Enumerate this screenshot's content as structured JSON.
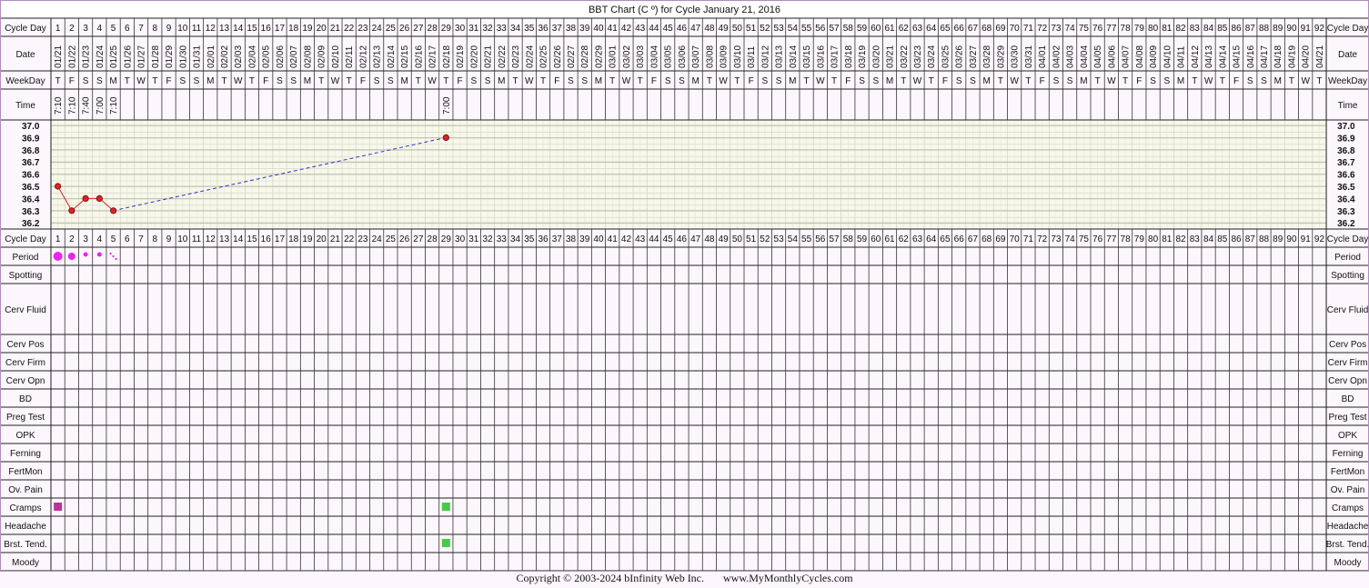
{
  "title": "BBT Chart (C º) for Cycle January 21, 2016",
  "row_labels": {
    "cycle_day": "Cycle Day",
    "date": "Date",
    "weekday": "WeekDay",
    "time": "Time",
    "period": "Period",
    "spotting": "Spotting",
    "cerv_fluid": "Cerv Fluid",
    "cerv_pos": "Cerv Pos",
    "cerv_firm": "Cerv Firm",
    "cerv_opn": "Cerv Opn",
    "bd": "BD",
    "preg_test": "Preg Test",
    "opk": "OPK",
    "ferning": "Ferning",
    "fertmon": "FertMon",
    "ov_pain": "Ov. Pain",
    "cramps": "Cramps",
    "headache": "Headache",
    "brst_tend": "Brst. Tend.",
    "moody": "Moody"
  },
  "days": [
    "1",
    "2",
    "3",
    "4",
    "5",
    "6",
    "7",
    "8",
    "9",
    "10",
    "11",
    "12",
    "13",
    "14",
    "15",
    "16",
    "17",
    "18",
    "19",
    "20",
    "21",
    "22",
    "23",
    "24",
    "25",
    "26",
    "27",
    "28",
    "29",
    "30",
    "31",
    "32",
    "33",
    "34",
    "35",
    "36",
    "37",
    "38",
    "39",
    "40",
    "41",
    "42",
    "43",
    "44",
    "45",
    "46",
    "47",
    "48",
    "49",
    "50",
    "51",
    "52",
    "53",
    "54",
    "55",
    "56",
    "57",
    "58",
    "59",
    "60",
    "61",
    "62",
    "63",
    "64",
    "65",
    "66",
    "67",
    "68",
    "69",
    "70",
    "71",
    "72",
    "73",
    "74",
    "75",
    "76",
    "77",
    "78",
    "79",
    "80",
    "81",
    "82",
    "83",
    "84",
    "85",
    "86",
    "87",
    "88",
    "89",
    "90",
    "91",
    "92"
  ],
  "dates": [
    "01/21",
    "01/22",
    "01/23",
    "01/24",
    "01/25",
    "01/26",
    "01/27",
    "01/28",
    "01/29",
    "01/30",
    "01/31",
    "02/01",
    "02/02",
    "02/03",
    "02/04",
    "02/05",
    "02/06",
    "02/07",
    "02/08",
    "02/09",
    "02/10",
    "02/11",
    "02/12",
    "02/13",
    "02/14",
    "02/15",
    "02/16",
    "02/17",
    "02/18",
    "02/19",
    "02/20",
    "02/21",
    "02/22",
    "02/23",
    "02/24",
    "02/25",
    "02/26",
    "02/27",
    "02/28",
    "02/29",
    "03/01",
    "03/02",
    "03/03",
    "03/04",
    "03/05",
    "03/06",
    "03/07",
    "03/08",
    "03/09",
    "03/10",
    "03/11",
    "03/12",
    "03/13",
    "03/14",
    "03/15",
    "03/16",
    "03/17",
    "03/18",
    "03/19",
    "03/20",
    "03/21",
    "03/22",
    "03/23",
    "03/24",
    "03/25",
    "03/26",
    "03/27",
    "03/28",
    "03/29",
    "03/30",
    "03/31",
    "04/01",
    "04/02",
    "04/03",
    "04/04",
    "04/05",
    "04/06",
    "04/07",
    "04/08",
    "04/09",
    "04/10",
    "04/11",
    "04/12",
    "04/13",
    "04/14",
    "04/15",
    "04/16",
    "04/17",
    "04/18",
    "04/19",
    "04/20",
    "04/21"
  ],
  "weekdays": [
    "T",
    "F",
    "S",
    "S",
    "M",
    "T",
    "W",
    "T",
    "F",
    "S",
    "S",
    "M",
    "T",
    "W",
    "T",
    "F",
    "S",
    "S",
    "M",
    "T",
    "W",
    "T",
    "F",
    "S",
    "S",
    "M",
    "T",
    "W",
    "T",
    "F",
    "S",
    "S",
    "M",
    "T",
    "W",
    "T",
    "F",
    "S",
    "S",
    "M",
    "T",
    "W",
    "T",
    "F",
    "S",
    "S",
    "M",
    "T",
    "W",
    "T",
    "F",
    "S",
    "S",
    "M",
    "T",
    "W",
    "T",
    "F",
    "S",
    "S",
    "M",
    "T",
    "W",
    "T",
    "F",
    "S",
    "S",
    "M",
    "T",
    "W",
    "T",
    "F",
    "S",
    "S",
    "M",
    "T",
    "W",
    "T",
    "F",
    "S",
    "S",
    "M",
    "T",
    "W",
    "T",
    "F",
    "S",
    "S",
    "M",
    "T",
    "W",
    "T"
  ],
  "chart_data": {
    "type": "line",
    "title": "BBT Chart (C º) for Cycle January 21, 2016",
    "x": [
      1,
      2,
      3,
      4,
      5,
      29
    ],
    "y": [
      36.5,
      36.3,
      36.4,
      36.4,
      36.3,
      36.9
    ],
    "times": [
      "7:10",
      "7:10",
      "7:40",
      "7:00",
      "7:10",
      "7:00"
    ],
    "dashed_gap": [
      5,
      29
    ],
    "y_ticks": [
      "37.0",
      "36.9",
      "36.8",
      "36.7",
      "36.6",
      "36.5",
      "36.4",
      "36.3",
      "36.2"
    ],
    "ylim": [
      36.2,
      37.0
    ],
    "xlim": [
      1,
      92
    ],
    "grid": true,
    "colors": {
      "line": "#dd2222",
      "gap_line": "#3333cc",
      "point": "#dd2222",
      "period": "#ee22ee",
      "cramps_day1": "#bb3399",
      "symptom": "#44cc44"
    }
  },
  "period": [
    {
      "day": 1,
      "level": "heavy"
    },
    {
      "day": 2,
      "level": "medium"
    },
    {
      "day": 3,
      "level": "light"
    },
    {
      "day": 4,
      "level": "light"
    },
    {
      "day": 5,
      "level": "spotting"
    }
  ],
  "cramps": [
    {
      "day": 1,
      "color": "#bb3399"
    },
    {
      "day": 29,
      "color": "#44cc44"
    }
  ],
  "brst_tend": [
    {
      "day": 29,
      "color": "#44cc44"
    }
  ],
  "footer": {
    "copyright": "Copyright © 2003-2024 bInfinity Web Inc.",
    "site": "www.MyMonthlyCycles.com"
  }
}
